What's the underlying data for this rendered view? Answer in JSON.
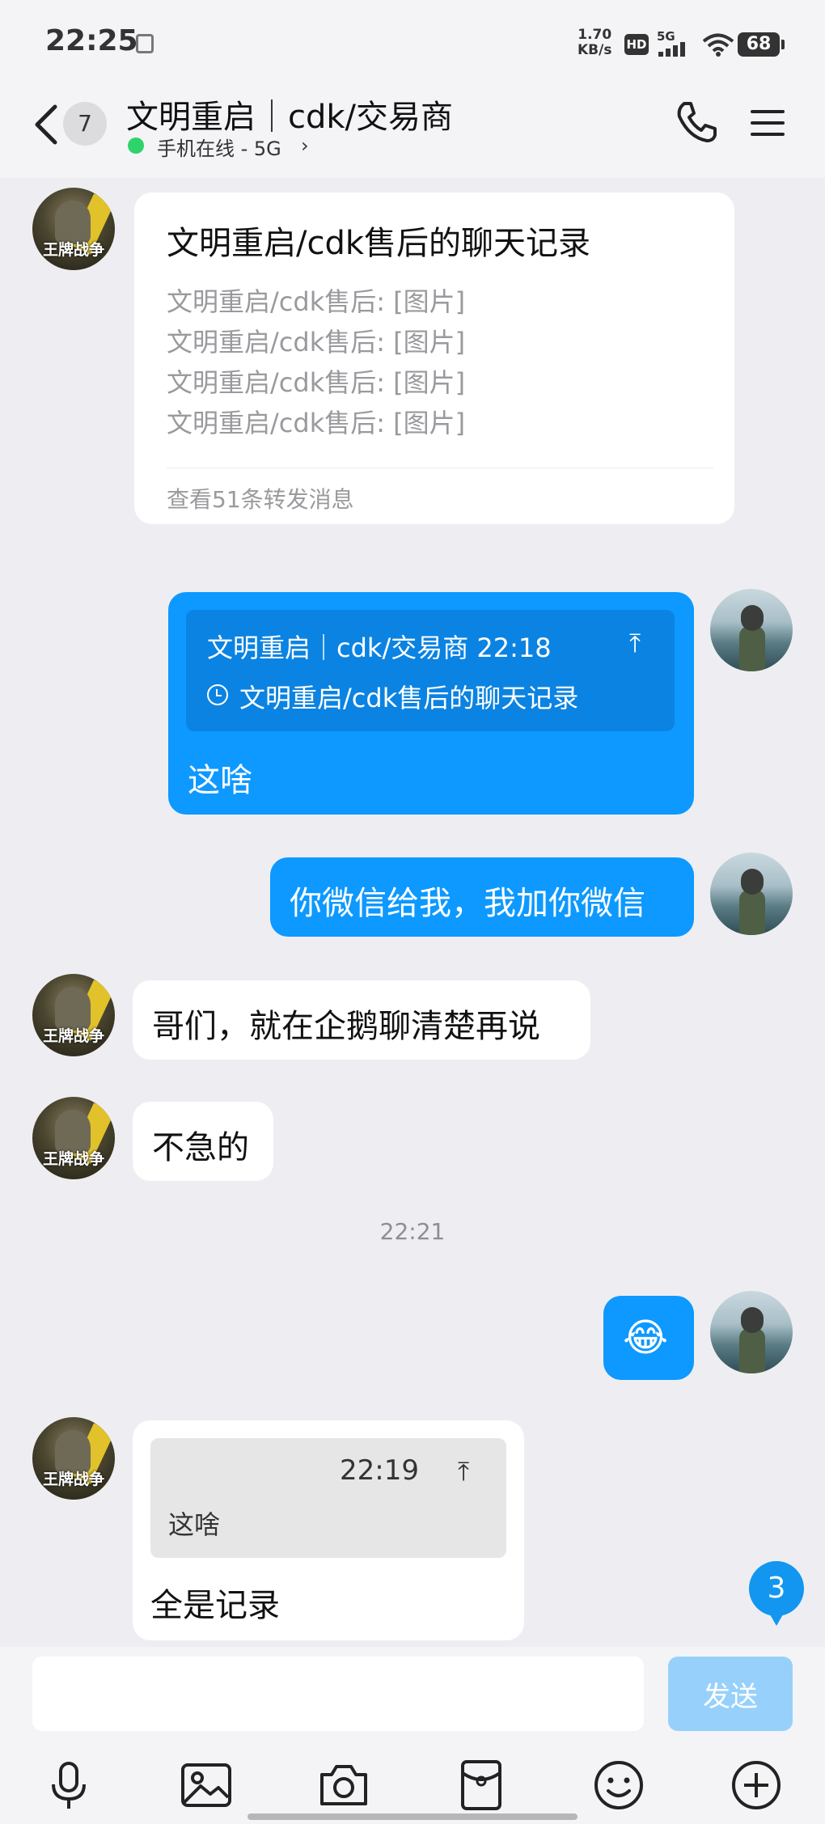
{
  "status_bar": {
    "time": "22:25",
    "net_speed_value": "1.70",
    "net_speed_unit": "KB/s",
    "hd_label": "HD",
    "signal_label": "5G",
    "battery": "68"
  },
  "header": {
    "unread_count": "7",
    "title": "文明重启｜cdk/交易商",
    "online_status": "手机在线 - 5G",
    "online_color": "#2ed36b"
  },
  "messages": {
    "forward_card": {
      "title": "文明重启/cdk售后的聊天记录",
      "lines": [
        "文明重启/cdk售后: [图片]",
        "文明重启/cdk售后: [图片]",
        "文明重启/cdk售后: [图片]",
        "文明重启/cdk售后: [图片]"
      ],
      "footer": "查看51条转发消息"
    },
    "reply_1": {
      "quote_header": "文明重启｜cdk/交易商 22:18",
      "quote_content": "文明重启/cdk售后的聊天记录",
      "text": "这啥"
    },
    "sent_1": "你微信给我，我加你微信",
    "recv_1": "哥们，就在企鹅聊清楚再说",
    "recv_2": "不急的",
    "timestamp": "22:21",
    "emoji": "😂",
    "reply_2": {
      "quote_time": "22:19",
      "quote_content": "这啥",
      "text": "全是记录"
    }
  },
  "avatar_other_logo": "王牌战争",
  "scroll_badge": "3",
  "input": {
    "placeholder": "",
    "send_label": "发送"
  },
  "colors": {
    "accent": "#0d99ff",
    "send_disabled": "#97d1fb",
    "background": "#eeeef2"
  },
  "toolbar_icons": [
    "microphone-icon",
    "image-icon",
    "camera-icon",
    "red-packet-icon",
    "emoji-icon",
    "plus-icon"
  ]
}
